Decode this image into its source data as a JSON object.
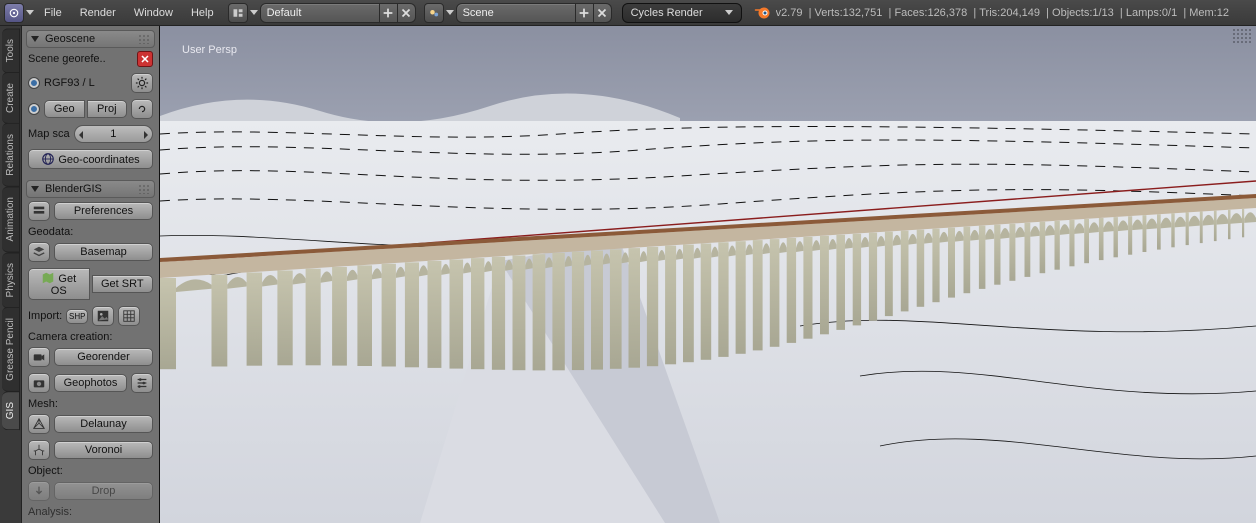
{
  "header": {
    "menus": [
      "File",
      "Render",
      "Window",
      "Help"
    ],
    "layout_field": "Default",
    "scene_field": "Scene",
    "engine": "Cycles Render",
    "version": "v2.79",
    "stats": {
      "verts": "Verts:132,751",
      "faces": "Faces:126,378",
      "tris": "Tris:204,149",
      "objects": "Objects:1/13",
      "lamps": "Lamps:0/1",
      "mem": "Mem:12"
    }
  },
  "side_tabs": [
    "Tools",
    "Create",
    "Relations",
    "Animation",
    "Physics",
    "Grease Pencil",
    "GIS"
  ],
  "side_tabs_active": "GIS",
  "panel": {
    "geoscene": {
      "title": "Geoscene",
      "scene_georef_label": "Scene georefe..",
      "crs_label": "RGF93 / L",
      "geo_btn": "Geo",
      "proj_btn": "Proj",
      "map_scale_label": "Map sca",
      "map_scale_value": "1",
      "geocoords_btn": "Geo-coordinates"
    },
    "blendergis": {
      "title": "BlenderGIS",
      "prefs_btn": "Preferences",
      "geodata_label": "Geodata:",
      "basemap_btn": "Basemap",
      "get_osm_btn": "Get OS",
      "get_srtm_btn": "Get SRT",
      "import_label": "Import:",
      "camera_label": "Camera creation:",
      "georender_btn": "Georender",
      "geophotos_btn": "Geophotos",
      "mesh_label": "Mesh:",
      "delaunay_btn": "Delaunay",
      "voronoi_btn": "Voronoi",
      "object_label": "Object:",
      "drop_btn": "Drop",
      "analysis_label": "Analysis:"
    }
  },
  "viewport": {
    "label": "User Persp"
  }
}
